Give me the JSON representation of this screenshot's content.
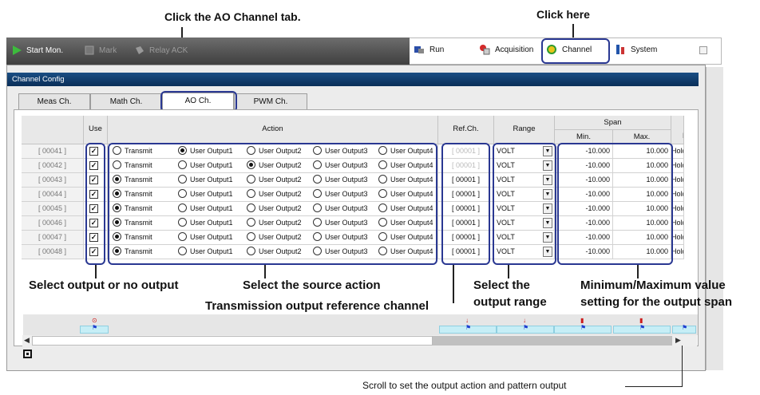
{
  "callouts": {
    "ao_tab": "Click the AO Channel tab.",
    "click_here": "Click here",
    "select_output": "Select output or no output",
    "select_action": "Select the source action",
    "ref_channel": "Transmission output reference channel",
    "range_line1": "Select the",
    "range_line2": "output range",
    "span_line1": "Minimum/Maximum value",
    "span_line2": "setting for the output span",
    "scroll": "Scroll to set the output action and pattern output"
  },
  "toolbar": {
    "start_mon": "Start Mon.",
    "mark": "Mark",
    "relay_ack": "Relay ACK",
    "run": "Run",
    "acquisition": "Acquisition",
    "channel": "Channel",
    "system": "System"
  },
  "window": {
    "title": "Channel Config"
  },
  "tabs": [
    "Meas Ch.",
    "Math Ch.",
    "AO Ch.",
    "PWM Ch."
  ],
  "active_tab": "AO Ch.",
  "headers": {
    "use": "Use",
    "action": "Action",
    "ref_ch": "Ref.Ch.",
    "range": "Range",
    "span": "Span",
    "min": "Min.",
    "max": "Max.",
    "next": "F"
  },
  "action_options": [
    "Transmit",
    "User Output1",
    "User Output2",
    "User Output3",
    "User Output4"
  ],
  "rows": [
    {
      "ch": "[ 00041 ]",
      "use": true,
      "action": "User Output1",
      "ref": "[ 00001 ]",
      "ref_dim": true,
      "range": "VOLT",
      "min": "-10.000",
      "max": "10.000",
      "tail": "Hold"
    },
    {
      "ch": "[ 00042 ]",
      "use": true,
      "action": "User Output2",
      "ref": "[ 00001 ]",
      "ref_dim": true,
      "range": "VOLT",
      "min": "-10.000",
      "max": "10.000",
      "tail": "Hold"
    },
    {
      "ch": "[ 00043 ]",
      "use": true,
      "action": "Transmit",
      "ref": "[ 00001 ]",
      "ref_dim": false,
      "range": "VOLT",
      "min": "-10.000",
      "max": "10.000",
      "tail": "Hold"
    },
    {
      "ch": "[ 00044 ]",
      "use": true,
      "action": "Transmit",
      "ref": "[ 00001 ]",
      "ref_dim": false,
      "range": "VOLT",
      "min": "-10.000",
      "max": "10.000",
      "tail": "Hold"
    },
    {
      "ch": "[ 00045 ]",
      "use": true,
      "action": "Transmit",
      "ref": "[ 00001 ]",
      "ref_dim": false,
      "range": "VOLT",
      "min": "-10.000",
      "max": "10.000",
      "tail": "Hold"
    },
    {
      "ch": "[ 00046 ]",
      "use": true,
      "action": "Transmit",
      "ref": "[ 00001 ]",
      "ref_dim": false,
      "range": "VOLT",
      "min": "-10.000",
      "max": "10.000",
      "tail": "Hold"
    },
    {
      "ch": "[ 00047 ]",
      "use": true,
      "action": "Transmit",
      "ref": "[ 00001 ]",
      "ref_dim": false,
      "range": "VOLT",
      "min": "-10.000",
      "max": "10.000",
      "tail": "Hold"
    },
    {
      "ch": "[ 00048 ]",
      "use": true,
      "action": "Transmit",
      "ref": "[ 00001 ]",
      "ref_dim": false,
      "range": "VOLT",
      "min": "-10.000",
      "max": "10.000",
      "tail": "Hold"
    }
  ],
  "colors": {
    "highlight": "#2a3892",
    "titlebar": "#0a2e58",
    "marker_red": "#cc1a1a",
    "marker_blue": "#1f3fd0"
  }
}
